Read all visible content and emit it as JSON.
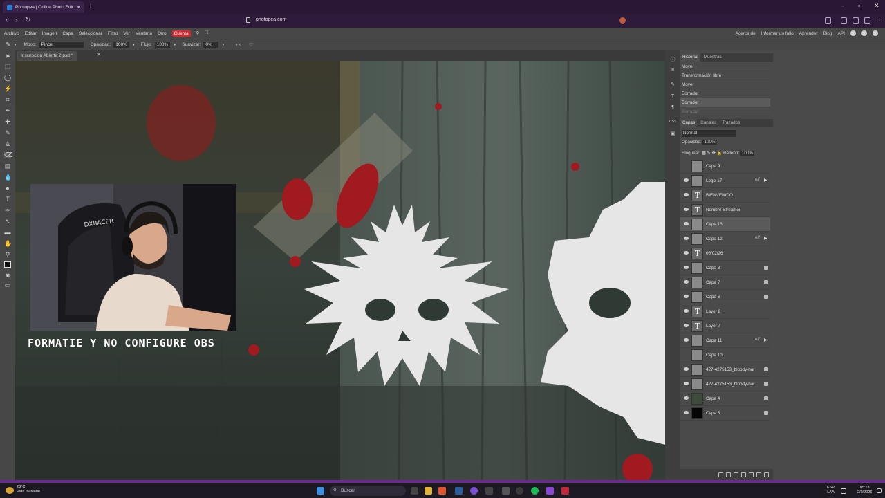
{
  "browser": {
    "tab_title": "Photopea | Online Photo Editor",
    "url": "photopea.com"
  },
  "menu": {
    "items": [
      "Archivo",
      "Editar",
      "Imagen",
      "Capa",
      "Seleccionar",
      "Filtro",
      "Ver",
      "Ventana",
      "Otro"
    ],
    "account": "Cuenta",
    "right_links": [
      "Acerca de",
      "Informar un fallo",
      "Aprender",
      "Blog",
      "API"
    ]
  },
  "options": {
    "mode_label": "Modo:",
    "mode_value": "Pincel",
    "opacity_label": "Opacidad:",
    "opacity_value": "100%",
    "flow_label": "Flujo:",
    "flow_value": "100%",
    "smooth_label": "Suavizar:",
    "smooth_value": "0%"
  },
  "document": {
    "tab": "Inscripcion Abierta 2.psd *"
  },
  "canvas": {
    "overlay_text": "FORMATIE Y NO CONFIGURE OBS",
    "chair_brand": "DXRACER"
  },
  "history_panel": {
    "tabs": [
      "Historial",
      "Muestras"
    ],
    "items": [
      "Mover",
      "Transformación libre",
      "Mover",
      "Borrador",
      "Borrador",
      "Borrador"
    ]
  },
  "layers_panel": {
    "tabs": [
      "Capas",
      "Canales",
      "Trazados"
    ],
    "blend_mode": "Normal",
    "opacity_label": "Opacidad:",
    "opacity_value": "100%",
    "lock_label": "Bloquear:",
    "fill_label": "Relleno:",
    "fill_value": "100%",
    "layers": [
      {
        "name": "Capa 9"
      },
      {
        "name": "Logo-17"
      },
      {
        "name": "BIENVENIDO"
      },
      {
        "name": "Nombre Streamer"
      },
      {
        "name": "Capa 13"
      },
      {
        "name": "Capa 12"
      },
      {
        "name": "06/02/26"
      },
      {
        "name": "Capa 8"
      },
      {
        "name": "Capa 7"
      },
      {
        "name": "Capa 6"
      },
      {
        "name": "Layer 8"
      },
      {
        "name": "Layer 7"
      },
      {
        "name": "Capa 11"
      },
      {
        "name": "Capa 10"
      },
      {
        "name": "427-4275153_bloody-har"
      },
      {
        "name": "427-4275153_bloody-har"
      },
      {
        "name": "Capa 4"
      },
      {
        "name": "Capa 5"
      }
    ],
    "fx_label": "eff"
  },
  "taskbar": {
    "weather_temp": "23°C",
    "weather_desc": "Parc. nublado",
    "search_placeholder": "Buscar",
    "lang_1": "ESP",
    "lang_2": "LAA",
    "time": "05:23",
    "date": "2/2/2026"
  }
}
